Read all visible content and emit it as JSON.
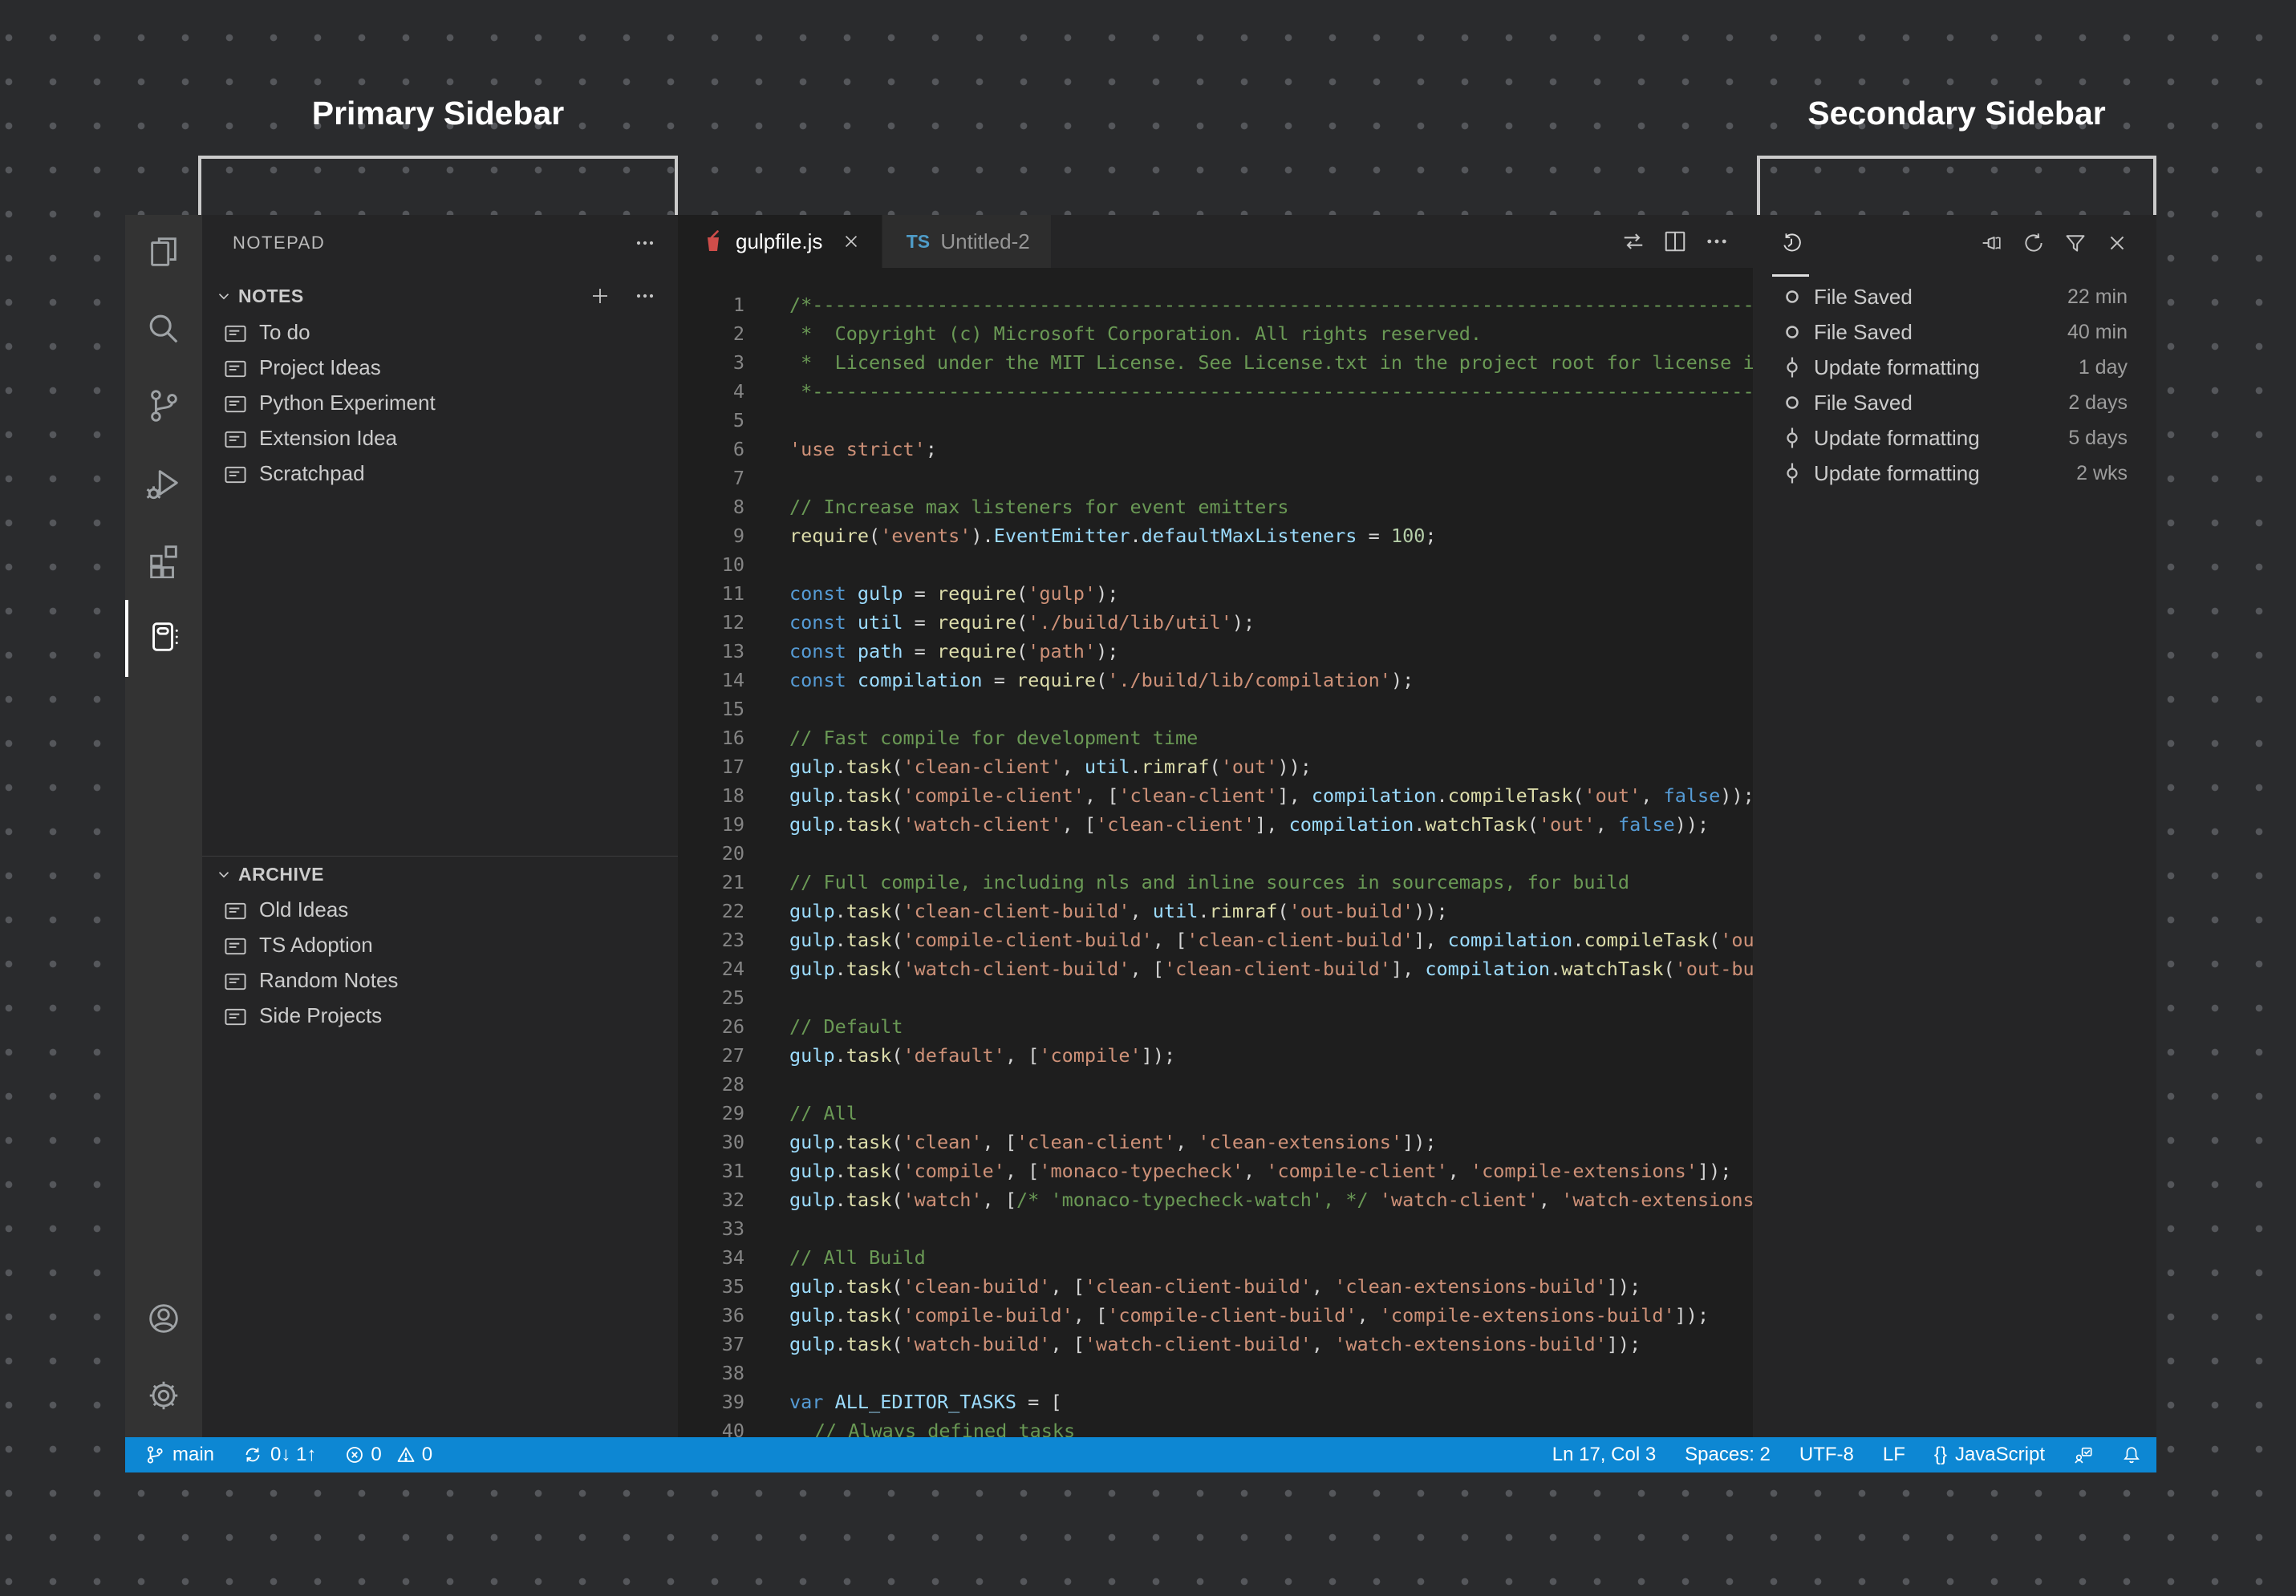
{
  "annotations": {
    "primary_label": "Primary Sidebar",
    "secondary_label": "Secondary Sidebar",
    "box_border_color": "#cbcbcb"
  },
  "window": {
    "activity_bar": {
      "top_items": [
        {
          "icon": "files-icon",
          "active": false
        },
        {
          "icon": "search-icon",
          "active": false
        },
        {
          "icon": "source-control-icon",
          "active": false
        },
        {
          "icon": "run-debug-icon",
          "active": false
        },
        {
          "icon": "extensions-icon",
          "active": false
        },
        {
          "icon": "notepad-icon",
          "active": true
        }
      ],
      "bottom_items": [
        {
          "icon": "account-icon",
          "active": false
        },
        {
          "icon": "settings-icon",
          "active": false
        }
      ]
    },
    "sidebar": {
      "title": "NOTEPAD",
      "notes_section": "NOTES",
      "archive_section": "ARCHIVE",
      "notes_items": [
        {
          "label": "To do"
        },
        {
          "label": "Project Ideas"
        },
        {
          "label": "Python Experiment"
        },
        {
          "label": "Extension Idea"
        },
        {
          "label": "Scratchpad"
        }
      ],
      "archive_items": [
        {
          "label": "Old Ideas"
        },
        {
          "label": "TS Adoption"
        },
        {
          "label": "Random Notes"
        },
        {
          "label": "Side Projects"
        }
      ]
    },
    "editor": {
      "tabs": [
        {
          "label": "gulpfile.js",
          "icon": "gulp-icon",
          "active": true,
          "closable": true
        },
        {
          "label": "Untitled-2",
          "icon": "ts-icon",
          "active": false,
          "closable": false
        }
      ],
      "code_lines": [
        "/*---------------------------------------------------------------------------------------------",
        " *  Copyright (c) Microsoft Corporation. All rights reserved.",
        " *  Licensed under the MIT License. See License.txt in the project root for license information.",
        " *--------------------------------------------------------------------------------------------*/",
        "",
        "'use strict';",
        "",
        "// Increase max listeners for event emitters",
        "require('events').EventEmitter.defaultMaxListeners = 100;",
        "",
        "const gulp = require('gulp');",
        "const util = require('./build/lib/util');",
        "const path = require('path');",
        "const compilation = require('./build/lib/compilation');",
        "",
        "// Fast compile for development time",
        "gulp.task('clean-client', util.rimraf('out'));",
        "gulp.task('compile-client', ['clean-client'], compilation.compileTask('out', false));",
        "gulp.task('watch-client', ['clean-client'], compilation.watchTask('out', false));",
        "",
        "// Full compile, including nls and inline sources in sourcemaps, for build",
        "gulp.task('clean-client-build', util.rimraf('out-build'));",
        "gulp.task('compile-client-build', ['clean-client-build'], compilation.compileTask('out-build', true));",
        "gulp.task('watch-client-build', ['clean-client-build'], compilation.watchTask('out-build', true));",
        "",
        "// Default",
        "gulp.task('default', ['compile']);",
        "",
        "// All",
        "gulp.task('clean', ['clean-client', 'clean-extensions']);",
        "gulp.task('compile', ['monaco-typecheck', 'compile-client', 'compile-extensions']);",
        "gulp.task('watch', [/* 'monaco-typecheck-watch', */ 'watch-client', 'watch-extensions']);",
        "",
        "// All Build",
        "gulp.task('clean-build', ['clean-client-build', 'clean-extensions-build']);",
        "gulp.task('compile-build', ['compile-client-build', 'compile-extensions-build']);",
        "gulp.task('watch-build', ['watch-client-build', 'watch-extensions-build']);",
        "",
        "var ALL_EDITOR_TASKS = [",
        "\t// Always defined tasks"
      ],
      "syntax_colors": {
        "comment": "#6A9955",
        "string": "#ce9178",
        "keyword": "#569cd6",
        "number": "#b5cea8",
        "function": "#dcdcaa",
        "identifier": "#9cdcfe",
        "punctuation": "#d4d4d4"
      }
    },
    "timeline": {
      "entries": [
        {
          "label": "File Saved",
          "time": "22 min",
          "icon": "save-state-icon"
        },
        {
          "label": "File Saved",
          "time": "40 min",
          "icon": "save-state-icon"
        },
        {
          "label": "Update formatting",
          "time": "1 day",
          "icon": "commit-icon"
        },
        {
          "label": "File Saved",
          "time": "2 days",
          "icon": "save-state-icon"
        },
        {
          "label": "Update formatting",
          "time": "5 days",
          "icon": "commit-icon"
        },
        {
          "label": "Update formatting",
          "time": "2 wks",
          "icon": "commit-icon"
        }
      ]
    },
    "status_bar": {
      "branch": "main",
      "sync": "0↓ 1↑",
      "errors": "0",
      "warnings": "0",
      "line_col": "Ln 17, Col 3",
      "spaces": "Spaces: 2",
      "encoding": "UTF-8",
      "eol": "LF",
      "language_braces": "{}",
      "language": "JavaScript"
    }
  }
}
